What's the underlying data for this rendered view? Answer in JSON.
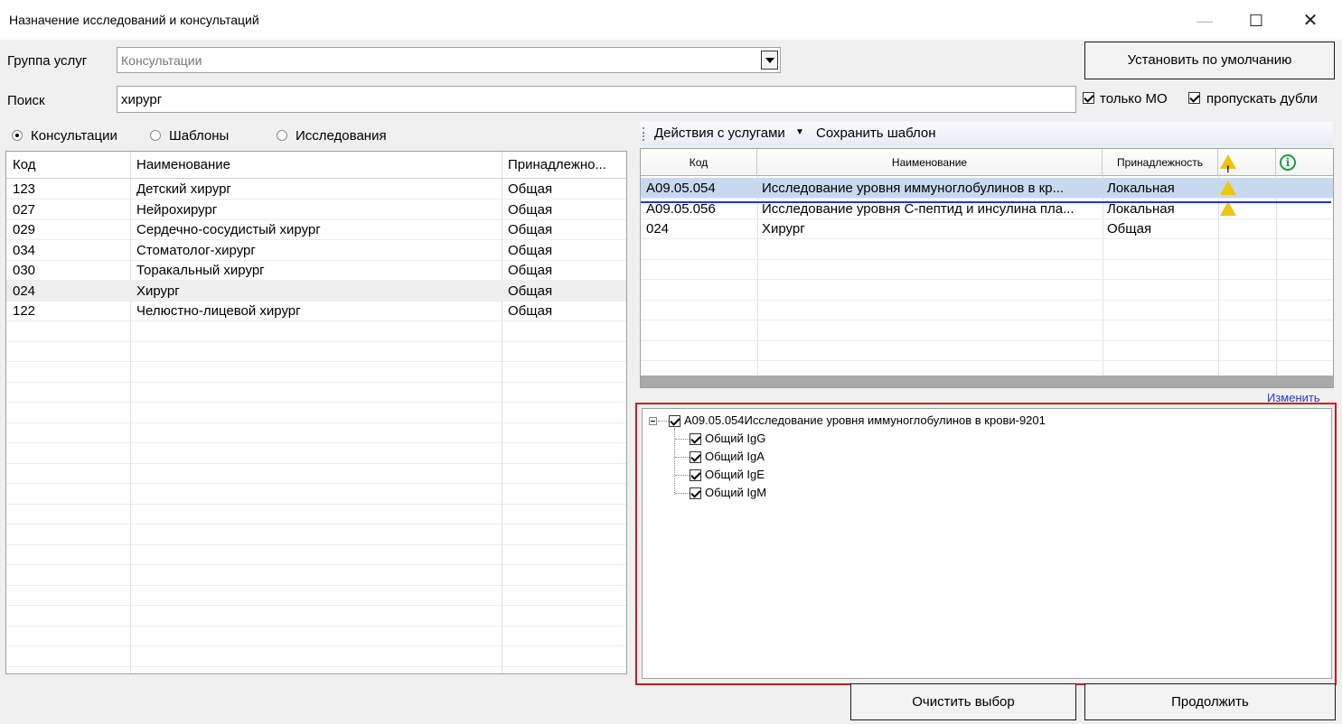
{
  "window": {
    "title": "Назначение исследований и консультаций",
    "minimize": "—",
    "maximize": "☐",
    "close": "✕"
  },
  "filters": {
    "group_label": "Группа услуг",
    "group_value": "Консультации",
    "search_label": "Поиск",
    "search_value": "хирург",
    "default_button": "Установить по умолчанию",
    "only_mo_label": "только МО",
    "only_mo_checked": true,
    "skip_duplicates_label": "пропускать дубли",
    "skip_duplicates_checked": true
  },
  "tabs": {
    "consultations": "Консультации",
    "templates": "Шаблоны",
    "research": "Исследования",
    "selected": "consultations"
  },
  "left_table": {
    "columns": [
      "Код",
      "Наименование",
      "Принадлежно..."
    ],
    "rows": [
      {
        "code": "123",
        "name": "Детский хирург",
        "belong": "Общая"
      },
      {
        "code": "027",
        "name": "Нейрохирург",
        "belong": "Общая"
      },
      {
        "code": "029",
        "name": "Сердечно-сосудистый хирург",
        "belong": "Общая"
      },
      {
        "code": "034",
        "name": "Стоматолог-хирург",
        "belong": "Общая"
      },
      {
        "code": "030",
        "name": "Торакальный хирург",
        "belong": "Общая"
      },
      {
        "code": "024",
        "name": "Хирург",
        "belong": "Общая"
      },
      {
        "code": "122",
        "name": "Челюстно-лицевой хирург",
        "belong": "Общая"
      }
    ]
  },
  "toolbar": {
    "actions": "Действия с услугами",
    "save_template": "Сохранить шаблон"
  },
  "right_table": {
    "columns": [
      "Код",
      "Наименование",
      "Принадлежность"
    ],
    "rows": [
      {
        "code": "A09.05.054",
        "name": "Исследование уровня иммуноглобулинов в кр...",
        "belong": "Локальная",
        "warn": true
      },
      {
        "code": "A09.05.056",
        "name": "Исследование уровня С-пептид и инсулина пла...",
        "belong": "Локальная",
        "warn": true
      },
      {
        "code": "024",
        "name": "Хирург",
        "belong": "Общая",
        "warn": false
      }
    ]
  },
  "edit_link": "Изменить",
  "tree": {
    "root": "A09.05.054Исследование уровня иммуноглобулинов в крови-9201",
    "children": [
      "Общий IgG",
      "Общий IgA",
      "Общий IgE",
      "Общий IgM"
    ]
  },
  "buttons": {
    "clear": "Очистить выбор",
    "continue": "Продолжить"
  },
  "colors": {
    "selection": "#c7d9ef",
    "highlight_box": "#d01818",
    "link": "#1f3cdd",
    "underline": "#1e38d8"
  }
}
